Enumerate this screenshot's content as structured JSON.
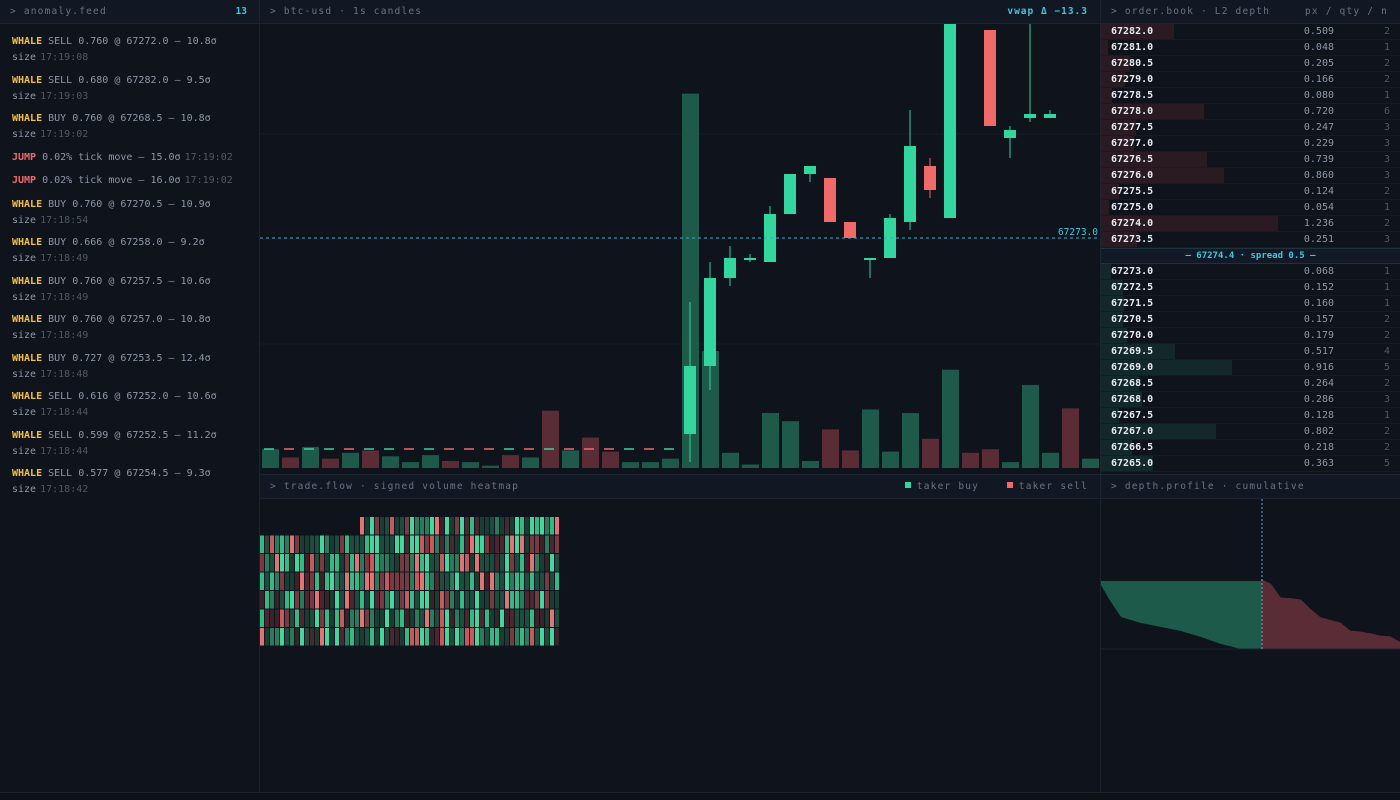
{
  "feed": {
    "title": "> anomaly.feed",
    "count": "13",
    "items": [
      {
        "kind": "WHALE",
        "text": "SELL 0.760 @ 67272.0 — 10.8σ size",
        "time": "17:19:08"
      },
      {
        "kind": "WHALE",
        "text": "SELL 0.680 @ 67282.0 — 9.5σ size",
        "time": "17:19:03"
      },
      {
        "kind": "WHALE",
        "text": "BUY 0.760 @ 67268.5 — 10.8σ size",
        "time": "17:19:02"
      },
      {
        "kind": "JUMP",
        "text": "0.02% tick move — 15.0σ",
        "time": "17:19:02"
      },
      {
        "kind": "JUMP",
        "text": "0.02% tick move — 16.0σ",
        "time": "17:19:02"
      },
      {
        "kind": "WHALE",
        "text": "BUY 0.760 @ 67270.5 — 10.9σ size",
        "time": "17:18:54"
      },
      {
        "kind": "WHALE",
        "text": "BUY 0.666 @ 67258.0 — 9.2σ size",
        "time": "17:18:49"
      },
      {
        "kind": "WHALE",
        "text": "BUY 0.760 @ 67257.5 — 10.6σ size",
        "time": "17:18:49"
      },
      {
        "kind": "WHALE",
        "text": "BUY 0.760 @ 67257.0 — 10.8σ size",
        "time": "17:18:49"
      },
      {
        "kind": "WHALE",
        "text": "BUY 0.727 @ 67253.5 — 12.4σ size",
        "time": "17:18:48"
      },
      {
        "kind": "WHALE",
        "text": "SELL 0.616 @ 67252.0 — 10.6σ size",
        "time": "17:18:44"
      },
      {
        "kind": "WHALE",
        "text": "SELL 0.599 @ 67252.5 — 11.2σ size",
        "time": "17:18:44"
      },
      {
        "kind": "WHALE",
        "text": "SELL 0.577 @ 67254.5 — 9.3σ size",
        "time": "17:18:42"
      }
    ]
  },
  "chart": {
    "title": "> btc-usd · 1s candles",
    "vwap": "vwap Δ −13.3",
    "last_price_label": "67273.0",
    "colors": {
      "up": "#33d69f",
      "down": "#f06a6a"
    }
  },
  "chart_data": {
    "type": "candlestick",
    "title": "btc-usd · 1s candles",
    "last_price": 67273.0,
    "candles": [
      {
        "o": 67248.5,
        "h": 67265.0,
        "l": 67245.0,
        "c": 67257.0
      },
      {
        "o": 67257.0,
        "h": 67270.0,
        "l": 67254.0,
        "c": 67268.0
      },
      {
        "o": 67268.0,
        "h": 67272.0,
        "l": 67267.0,
        "c": 67270.5
      },
      {
        "o": 67270.5,
        "h": 67271.0,
        "l": 67270.0,
        "c": 67270.5
      },
      {
        "o": 67270.0,
        "h": 67277.0,
        "l": 67270.0,
        "c": 67276.0
      },
      {
        "o": 67276.0,
        "h": 67281.0,
        "l": 67276.0,
        "c": 67281.0
      },
      {
        "o": 67281.0,
        "h": 67282.0,
        "l": 67280.0,
        "c": 67282.0
      },
      {
        "o": 67280.5,
        "h": 67280.5,
        "l": 67275.0,
        "c": 67275.0
      },
      {
        "o": 67275.0,
        "h": 67275.0,
        "l": 67273.0,
        "c": 67273.0
      },
      {
        "o": 67270.5,
        "h": 67270.5,
        "l": 67268.0,
        "c": 67270.5
      },
      {
        "o": 67270.5,
        "h": 67276.0,
        "l": 67270.5,
        "c": 67275.5
      },
      {
        "o": 67275.0,
        "h": 67289.0,
        "l": 67274.0,
        "c": 67284.5
      },
      {
        "o": 67282.0,
        "h": 67283.0,
        "l": 67278.0,
        "c": 67279.0
      },
      {
        "o": 67275.5,
        "h": 67305.0,
        "l": 67275.5,
        "c": 67303.0
      },
      {
        "o": 67308.0,
        "h": 67308.0,
        "l": 67302.0,
        "c": 67302.0
      },
      {
        "o": 67299.0,
        "h": 67299.0,
        "l": 67287.0,
        "c": 67287.0
      },
      {
        "o": 67285.5,
        "h": 67287.0,
        "l": 67283.0,
        "c": 67286.5
      },
      {
        "o": 67288.0,
        "h": 67307.0,
        "l": 67287.5,
        "c": 67288.5
      },
      {
        "o": 67288.0,
        "h": 67289.0,
        "l": 67288.0,
        "c": 67288.5
      }
    ],
    "volume": [
      1.6,
      0.9,
      1.8,
      0.8,
      1.3,
      1.5,
      1.0,
      0.5,
      1.1,
      0.6,
      0.5,
      0.2,
      1.1,
      0.9,
      4.9,
      1.5,
      2.6,
      1.4,
      0.5,
      0.5,
      0.8,
      32.0,
      10.0,
      1.3,
      0.3,
      4.7,
      4.0,
      0.6,
      3.3,
      1.5,
      5.0,
      1.4,
      4.7,
      2.5,
      8.4,
      1.3,
      1.6,
      0.5,
      7.1,
      1.3,
      5.1,
      0.8
    ]
  },
  "flow": {
    "title": "> trade.flow · signed volume heatmap",
    "legend_buy": "taker buy",
    "legend_sell": "taker sell",
    "colors": {
      "buy": "#33d69f",
      "sell": "#f06a6a"
    }
  },
  "book": {
    "title": "> order.book · L2 depth",
    "cols": "px / qty / n",
    "spread": "— 67274.4 · spread 0.5 —",
    "asks": [
      {
        "px": "67282.0",
        "qty": "0.509",
        "n": "2"
      },
      {
        "px": "67281.0",
        "qty": "0.048",
        "n": "1"
      },
      {
        "px": "67280.5",
        "qty": "0.205",
        "n": "2"
      },
      {
        "px": "67279.0",
        "qty": "0.166",
        "n": "2"
      },
      {
        "px": "67278.5",
        "qty": "0.080",
        "n": "1"
      },
      {
        "px": "67278.0",
        "qty": "0.720",
        "n": "6"
      },
      {
        "px": "67277.5",
        "qty": "0.247",
        "n": "3"
      },
      {
        "px": "67277.0",
        "qty": "0.229",
        "n": "3"
      },
      {
        "px": "67276.5",
        "qty": "0.739",
        "n": "3"
      },
      {
        "px": "67276.0",
        "qty": "0.860",
        "n": "3"
      },
      {
        "px": "67275.5",
        "qty": "0.124",
        "n": "2"
      },
      {
        "px": "67275.0",
        "qty": "0.054",
        "n": "1"
      },
      {
        "px": "67274.0",
        "qty": "1.236",
        "n": "2"
      },
      {
        "px": "67273.5",
        "qty": "0.251",
        "n": "3"
      }
    ],
    "bids": [
      {
        "px": "67273.0",
        "qty": "0.068",
        "n": "1"
      },
      {
        "px": "67272.5",
        "qty": "0.152",
        "n": "1"
      },
      {
        "px": "67271.5",
        "qty": "0.160",
        "n": "1"
      },
      {
        "px": "67270.5",
        "qty": "0.157",
        "n": "2"
      },
      {
        "px": "67270.0",
        "qty": "0.179",
        "n": "2"
      },
      {
        "px": "67269.5",
        "qty": "0.517",
        "n": "4"
      },
      {
        "px": "67269.0",
        "qty": "0.916",
        "n": "5"
      },
      {
        "px": "67268.5",
        "qty": "0.264",
        "n": "2"
      },
      {
        "px": "67268.0",
        "qty": "0.286",
        "n": "3"
      },
      {
        "px": "67267.5",
        "qty": "0.128",
        "n": "1"
      },
      {
        "px": "67267.0",
        "qty": "0.802",
        "n": "2"
      },
      {
        "px": "67266.5",
        "qty": "0.218",
        "n": "2"
      },
      {
        "px": "67265.0",
        "qty": "0.363",
        "n": "5"
      }
    ]
  },
  "depth": {
    "title": "> depth.profile · cumulative",
    "bid_cum": [
      0.36,
      0.58,
      1.38,
      1.51,
      1.8,
      2.06,
      2.98,
      3.5,
      3.68,
      3.84,
      4.0,
      4.15,
      4.22
    ],
    "ask_cum": [
      0.25,
      1.49,
      1.54,
      1.66,
      2.52,
      3.26,
      3.49,
      3.74,
      4.46,
      4.54,
      4.7,
      4.91,
      4.96,
      5.47
    ]
  }
}
